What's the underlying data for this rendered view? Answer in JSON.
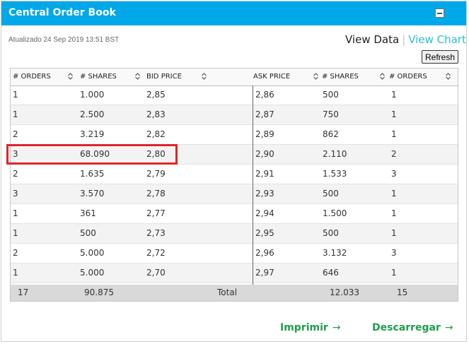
{
  "header": {
    "title": "Central Order Book",
    "collapse_icon": "minus-icon"
  },
  "updated": "Atualizado 24 Sep 2019 13:51 BST",
  "view": {
    "data_label": "View Data",
    "separator": "|",
    "chart_label": "View Chart"
  },
  "refresh_label": "Refresh",
  "columns": {
    "bid_orders": "# ORDERS",
    "bid_shares": "# SHARES",
    "bid_price": "BID PRICE",
    "ask_price": "ASK PRICE",
    "ask_shares": "# SHARES",
    "ask_orders": "# ORDERS"
  },
  "rows": [
    {
      "bid_orders": "1",
      "bid_shares": "1.000",
      "bid_price": "2,85",
      "ask_price": "2,86",
      "ask_shares": "500",
      "ask_orders": "1"
    },
    {
      "bid_orders": "1",
      "bid_shares": "2.500",
      "bid_price": "2,83",
      "ask_price": "2,87",
      "ask_shares": "750",
      "ask_orders": "1"
    },
    {
      "bid_orders": "2",
      "bid_shares": "3.219",
      "bid_price": "2,82",
      "ask_price": "2,89",
      "ask_shares": "862",
      "ask_orders": "1"
    },
    {
      "bid_orders": "3",
      "bid_shares": "68.090",
      "bid_price": "2,80",
      "ask_price": "2,90",
      "ask_shares": "2.110",
      "ask_orders": "2"
    },
    {
      "bid_orders": "2",
      "bid_shares": "1.635",
      "bid_price": "2,79",
      "ask_price": "2,91",
      "ask_shares": "1.533",
      "ask_orders": "3"
    },
    {
      "bid_orders": "3",
      "bid_shares": "3.570",
      "bid_price": "2,78",
      "ask_price": "2,93",
      "ask_shares": "500",
      "ask_orders": "1"
    },
    {
      "bid_orders": "1",
      "bid_shares": "361",
      "bid_price": "2,77",
      "ask_price": "2,94",
      "ask_shares": "1.500",
      "ask_orders": "1"
    },
    {
      "bid_orders": "1",
      "bid_shares": "500",
      "bid_price": "2,73",
      "ask_price": "2,95",
      "ask_shares": "500",
      "ask_orders": "1"
    },
    {
      "bid_orders": "2",
      "bid_shares": "5.000",
      "bid_price": "2,72",
      "ask_price": "2,96",
      "ask_shares": "3.132",
      "ask_orders": "3"
    },
    {
      "bid_orders": "1",
      "bid_shares": "5.000",
      "bid_price": "2,70",
      "ask_price": "2,97",
      "ask_shares": "646",
      "ask_orders": "1"
    }
  ],
  "totals": {
    "bid_orders": "17",
    "bid_shares": "90.875",
    "label": "Total",
    "ask_shares": "12.033",
    "ask_orders": "15"
  },
  "footer": {
    "print_label": "Imprimir",
    "download_label": "Descarregar",
    "arrow": "→"
  },
  "colors": {
    "header_bg": "#00a8e8",
    "accent_cyan": "#2ac0d1",
    "link_green": "#1f9e4d",
    "highlight": "#e0242b"
  }
}
